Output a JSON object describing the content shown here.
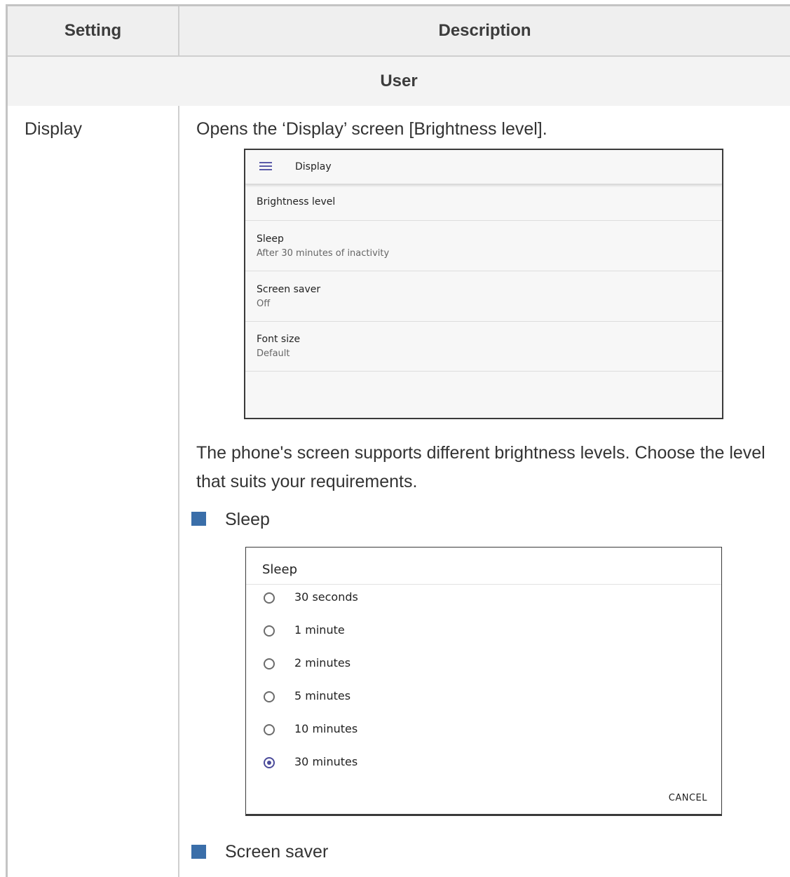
{
  "table": {
    "headers": {
      "setting": "Setting",
      "description": "Description"
    },
    "group": "User",
    "row": {
      "setting": "Display",
      "intro": "Opens the ‘Display’ screen [Brightness level].",
      "paragraph": "The phone's screen supports different brightness levels. Choose the level that suits your requirements.",
      "bullets": [
        "Sleep",
        "Screen saver"
      ]
    }
  },
  "display_screen": {
    "title": "Display",
    "items": [
      {
        "label": "Brightness level",
        "sub": ""
      },
      {
        "label": "Sleep",
        "sub": "After 30 minutes of inactivity"
      },
      {
        "label": "Screen saver",
        "sub": "Off"
      },
      {
        "label": "Font size",
        "sub": "Default"
      }
    ]
  },
  "sleep_dialog": {
    "title": "Sleep",
    "options": [
      "30 seconds",
      "1 minute",
      "2 minutes",
      "5 minutes",
      "10 minutes",
      "30 minutes"
    ],
    "selected": "30 minutes",
    "cancel": "CANCEL"
  },
  "colors": {
    "bullet": "#3a6ea9",
    "radio_accent": "#4b4b9a",
    "header_bg": "#efefef"
  },
  "icons": {
    "menu": "hamburger-menu-icon",
    "radio": "radio-button-icon"
  }
}
